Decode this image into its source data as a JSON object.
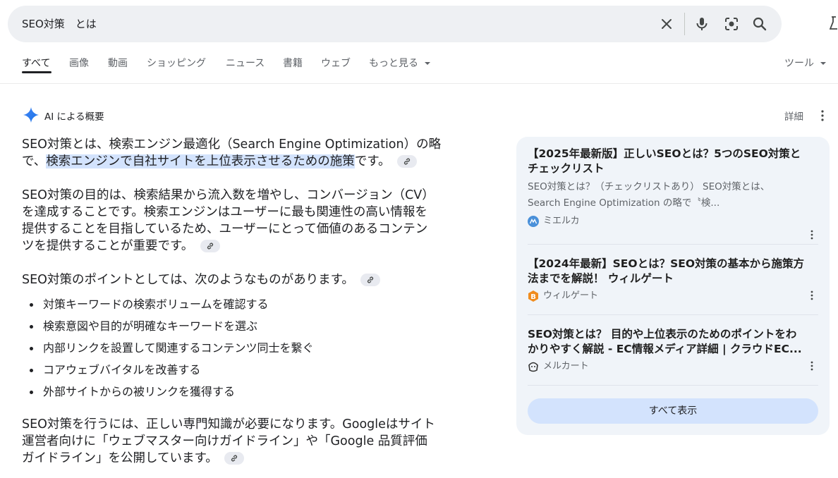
{
  "search": {
    "query": "SEO対策　とは",
    "icons": [
      "close-icon",
      "mic-icon",
      "lens-icon",
      "search-icon"
    ]
  },
  "tabs": [
    {
      "label": "すべて",
      "active": true
    },
    {
      "label": "画像"
    },
    {
      "label": "動画"
    },
    {
      "label": "ショッピング"
    },
    {
      "label": "ニュース"
    },
    {
      "label": "書籍"
    },
    {
      "label": "ウェブ"
    },
    {
      "label": "もっと見る"
    }
  ],
  "tools_label": "ツール",
  "ai_overview": {
    "label": "AI による概要",
    "details_label": "詳細",
    "p1_line1": "SEO対策とは、検索エンジン最適化（Search Engine Optimization）の略",
    "p1_line2_prefix": "で、",
    "p1_line2_highlight": "検索エンジンで自社サイトを上位表示させるための施策",
    "p1_line2_suffix": "です。",
    "p2_line1": "SEO対策の目的は、検索結果から流入数を増やし、コンバージョン（CV）",
    "p2_line2": "を達成することです。検索エンジンはユーザーに最も関連性の高い情報を",
    "p2_line3": "提供することを目指しているため、ユーザーにとって価値のあるコンテン",
    "p2_line4": "ツを提供することが重要です。",
    "p3": "SEO対策のポイントとしては、次のようなものがあります。",
    "bullets": [
      "対策キーワードの検索ボリュームを確認する",
      "検索意図や目的が明確なキーワードを選ぶ",
      "内部リンクを設置して関連するコンテンツ同士を繋ぐ",
      "コアウェブバイタルを改善する",
      "外部サイトからの被リンクを獲得する"
    ],
    "p4_line1": "SEO対策を行うには、正しい専門知識が必要になります。Googleはサイト",
    "p4_line2": "運営者向けに「ウェブマスター向けガイドライン」や「Google 品質評価",
    "p4_line3": "ガイドライン」を公開しています。"
  },
  "sources": [
    {
      "title_line1": "【2025年最新版】正しいSEOとは？5つのSEO対策と",
      "title_line2": "チェックリスト",
      "snippet_line1": "SEO対策とは？（チェックリストあり） SEO対策とは、",
      "snippet_line2": "Search Engine Optimization の略で〝検...",
      "site": "ミエルカ",
      "favicon_color": "#4a90d9"
    },
    {
      "title_line1": "【2024年最新】SEOとは？SEO対策の基本から施策方",
      "title_line2": "法までを解説！ ウィルゲート",
      "site": "ウィルゲート",
      "favicon_color": "#f08c1e"
    },
    {
      "title_line1": "SEO対策とは？ 目的や上位表示のためのポイントをわ",
      "title_line2": "かりやすく解説 - EC情報メディア詳細 | クラウドEC...",
      "site": "メルカート",
      "favicon_color": "#333333"
    }
  ],
  "show_all_label": "すべて表示",
  "colors": {
    "accent_blue": "#1a73e8",
    "highlight": "#d3e3fd",
    "panel_bg": "#f0f4f9",
    "search_bg": "#eef0f3"
  }
}
